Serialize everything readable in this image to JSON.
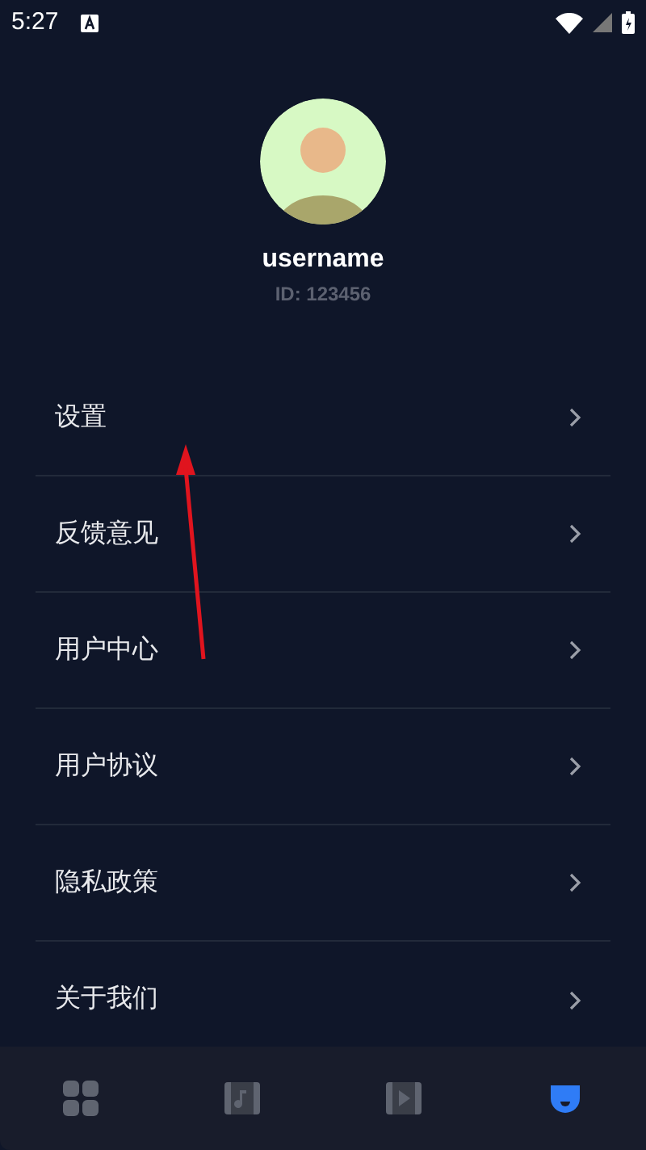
{
  "status_bar": {
    "time": "5:27"
  },
  "profile": {
    "username": "username",
    "id": "ID: 123456"
  },
  "menu": [
    {
      "label": "设置"
    },
    {
      "label": "反馈意见"
    },
    {
      "label": "用户中心"
    },
    {
      "label": "用户协议"
    },
    {
      "label": "隐私政策"
    },
    {
      "label": "关于我们"
    }
  ],
  "bottom_nav": [
    {
      "kind": "grid",
      "selected": false
    },
    {
      "kind": "music",
      "selected": false
    },
    {
      "kind": "video",
      "selected": false
    },
    {
      "kind": "profile",
      "selected": true
    }
  ]
}
